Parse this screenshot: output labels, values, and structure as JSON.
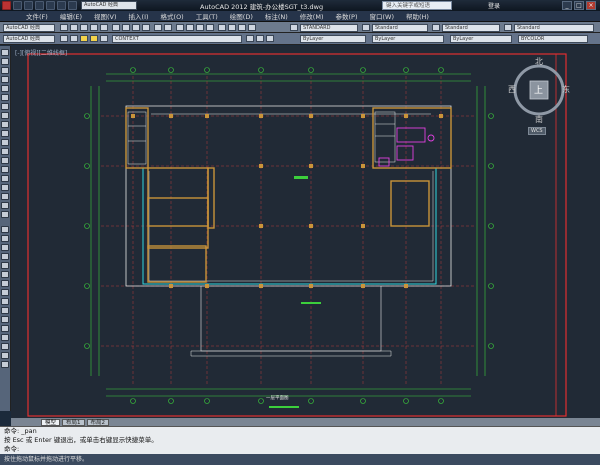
{
  "app": {
    "title": "AutoCAD 2012    建筑-办公楼SGT_t3.dwg",
    "search_placeholder": "键入关键字或短语",
    "login_label": "登录"
  },
  "menu": {
    "items": [
      "文件(F)",
      "编辑(E)",
      "视图(V)",
      "插入(I)",
      "格式(O)",
      "工具(T)",
      "绘图(D)",
      "标注(N)",
      "修改(M)",
      "参数(P)",
      "窗口(W)",
      "帮助(H)"
    ]
  },
  "toolbar": {
    "workspace": "AutoCAD 经典",
    "textstyle": "STANDARD",
    "dimstyle": "Standard",
    "tablestyle": "Standard",
    "mleaderstyle": "Standard",
    "layer": "CONTEXT",
    "color": "ByLayer",
    "linetype": "ByLayer",
    "lineweight": "ByLayer",
    "plotstyle": "BYCOLOR"
  },
  "viewport": {
    "label": "[-][俯视][二维线框]"
  },
  "viewcube": {
    "north": "北",
    "south": "南",
    "east": "东",
    "west": "西",
    "top": "上",
    "wcs": "WCS"
  },
  "tabs": [
    "模型",
    "布局1",
    "布局2"
  ],
  "command": {
    "line1": "命令: _pan",
    "line2": "按 Esc 或 Enter 键退出，或单击右键显示快捷菜单。",
    "prompt": "命令:"
  },
  "status": {
    "text": "按住拖动鼠标并拖动进行平移。"
  },
  "drawing": {
    "plan_title": "一层平面图"
  }
}
